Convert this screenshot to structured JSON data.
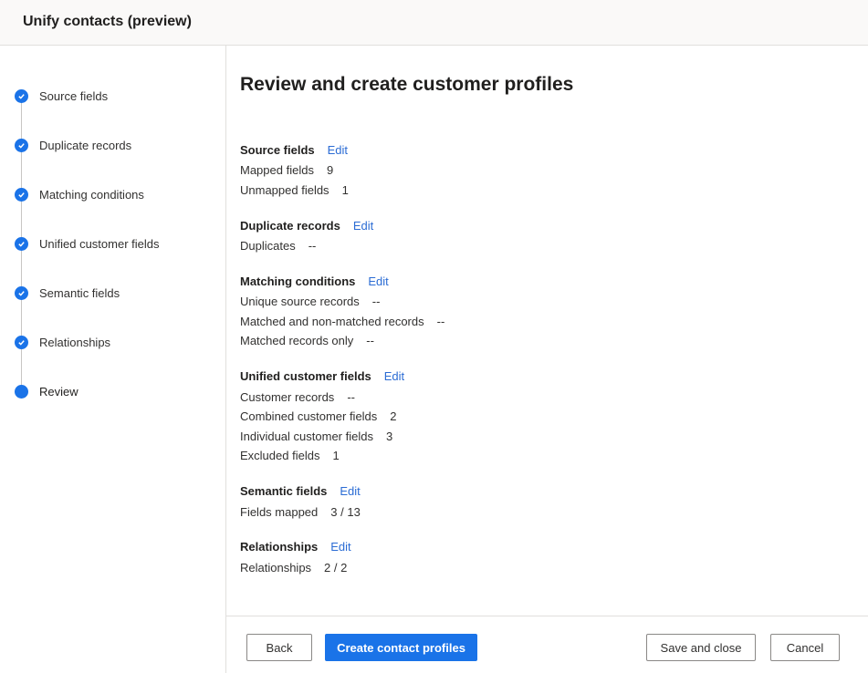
{
  "header": {
    "title": "Unify contacts (preview)"
  },
  "sidebar": {
    "steps": [
      {
        "label": "Source fields",
        "state": "done"
      },
      {
        "label": "Duplicate records",
        "state": "done"
      },
      {
        "label": "Matching conditions",
        "state": "done"
      },
      {
        "label": "Unified customer fields",
        "state": "done"
      },
      {
        "label": "Semantic fields",
        "state": "done"
      },
      {
        "label": "Relationships",
        "state": "done"
      },
      {
        "label": "Review",
        "state": "current"
      }
    ]
  },
  "main": {
    "title": "Review and create customer profiles",
    "edit_label": "Edit",
    "sections": [
      {
        "heading": "Source fields",
        "rows": [
          {
            "label": "Mapped fields",
            "value": "9"
          },
          {
            "label": "Unmapped fields",
            "value": "1"
          }
        ]
      },
      {
        "heading": "Duplicate records",
        "rows": [
          {
            "label": "Duplicates",
            "value": "--"
          }
        ]
      },
      {
        "heading": "Matching conditions",
        "rows": [
          {
            "label": "Unique source records",
            "value": "--"
          },
          {
            "label": "Matched and non-matched records",
            "value": "--"
          },
          {
            "label": "Matched records only",
            "value": "--"
          }
        ]
      },
      {
        "heading": "Unified customer fields",
        "rows": [
          {
            "label": "Customer records",
            "value": "--"
          },
          {
            "label": "Combined customer fields",
            "value": "2"
          },
          {
            "label": "Individual customer fields",
            "value": "3"
          },
          {
            "label": "Excluded fields",
            "value": "1"
          }
        ]
      },
      {
        "heading": "Semantic fields",
        "rows": [
          {
            "label": "Fields mapped",
            "value": "3 / 13"
          }
        ]
      },
      {
        "heading": "Relationships",
        "rows": [
          {
            "label": "Relationships",
            "value": "2 / 2"
          }
        ]
      }
    ]
  },
  "footer": {
    "back_label": "Back",
    "create_label": "Create contact profiles",
    "save_label": "Save and close",
    "cancel_label": "Cancel"
  },
  "colors": {
    "accent": "#1a73e8",
    "link": "#2b6cd4"
  }
}
